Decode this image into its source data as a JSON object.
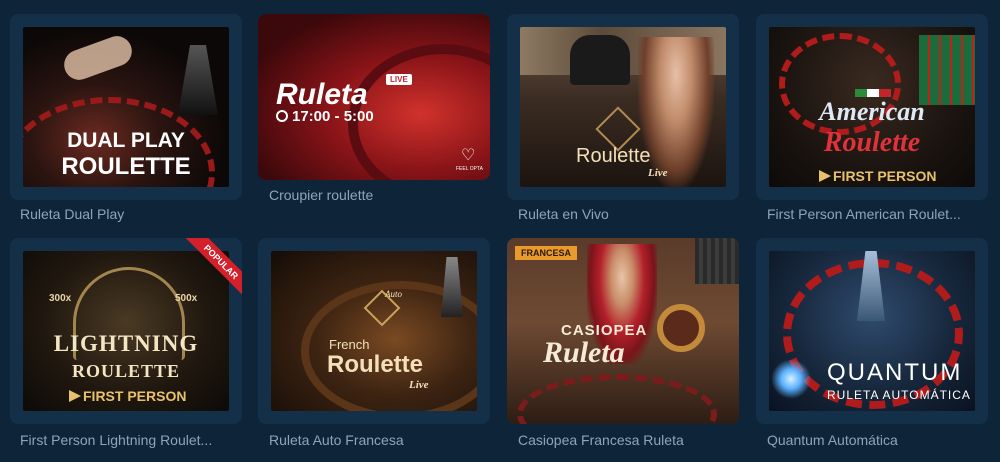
{
  "games": [
    {
      "id": "dual-play",
      "title": "Ruleta Dual Play",
      "art": [
        "DUAL PLAY",
        "ROULETTE"
      ]
    },
    {
      "id": "croupier",
      "title": "Croupier roulette",
      "art": [
        "Ruleta",
        "LIVE",
        "17:00 - 5:00",
        "FEEL OPTA"
      ]
    },
    {
      "id": "vivo",
      "title": "Ruleta en Vivo",
      "art": [
        "Roulette",
        "Live"
      ]
    },
    {
      "id": "american",
      "title": "First Person American Roulet...",
      "art": [
        "American",
        "Roulette",
        "FIRST PERSON"
      ]
    },
    {
      "id": "lightning",
      "title": "First Person Lightning Roulet...",
      "art": [
        "LIGHTNING",
        "ROULETTE",
        "FIRST PERSON",
        "POPULAR",
        "300x",
        "500x"
      ]
    },
    {
      "id": "auto-francesa",
      "title": "Ruleta Auto Francesa",
      "art": [
        "Auto",
        "French",
        "Roulette",
        "Live"
      ]
    },
    {
      "id": "casiopea",
      "title": "Casiopea Francesa Ruleta",
      "art": [
        "FRANCESA",
        "CASIOPEA",
        "Ruleta"
      ]
    },
    {
      "id": "quantum",
      "title": "Quantum Automática",
      "art": [
        "QUANTUM",
        "RULETA AUTOMÁTICA"
      ]
    }
  ],
  "colors": {
    "page_bg": "#0e2539",
    "card_bg": "#143049",
    "caption": "#8fa4b8",
    "accent_gold": "#e8c26a",
    "accent_red": "#d3202a"
  }
}
